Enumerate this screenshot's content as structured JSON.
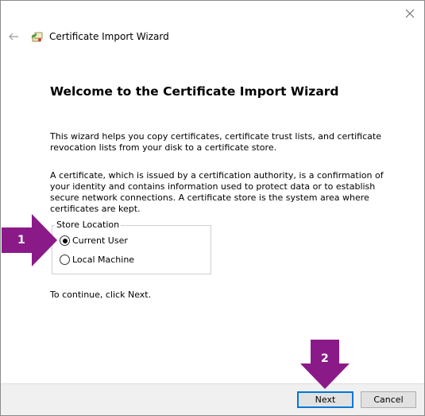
{
  "window": {
    "title": "Certificate Import Wizard",
    "close_icon": "close-icon",
    "back_icon": "back-arrow-icon",
    "wizard_icon": "certificate-icon"
  },
  "main": {
    "heading": "Welcome to the Certificate Import Wizard",
    "para1": "This wizard helps you copy certificates, certificate trust lists, and certificate revocation lists from your disk to a certificate store.",
    "para2": "A certificate, which is issued by a certification authority, is a confirmation of your identity and contains information used to protect data or to establish secure network connections. A certificate store is the system area where certificates are kept.",
    "store_location": {
      "label": "Store Location",
      "options": [
        {
          "label": "Current User",
          "checked": true
        },
        {
          "label": "Local Machine",
          "checked": false
        }
      ]
    },
    "continue_text": "To continue, click Next."
  },
  "footer": {
    "next_label": "Next",
    "cancel_label": "Cancel"
  },
  "annotations": {
    "callout1": "1",
    "callout2": "2",
    "color": "#8b1a89"
  }
}
